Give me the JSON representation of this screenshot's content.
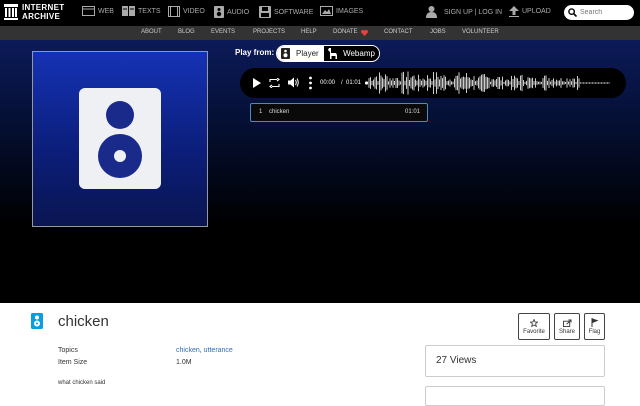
{
  "topbar": {
    "logo": {
      "line1": "INTERNET",
      "line2": "ARCHIVE"
    },
    "nav": [
      {
        "label": "WEB",
        "icon": "web-icon"
      },
      {
        "label": "TEXTS",
        "icon": "texts-icon"
      },
      {
        "label": "VIDEO",
        "icon": "video-icon"
      },
      {
        "label": "AUDIO",
        "icon": "audio-icon"
      },
      {
        "label": "SOFTWARE",
        "icon": "software-icon"
      },
      {
        "label": "IMAGES",
        "icon": "images-icon"
      }
    ],
    "signup": "SIGN UP | LOG IN",
    "upload": "UPLOAD",
    "search_placeholder": "Search"
  },
  "subnav": [
    "ABOUT",
    "BLOG",
    "EVENTS",
    "PROJECTS",
    "HELP",
    "DONATE",
    "CONTACT",
    "JOBS",
    "VOLUNTEER"
  ],
  "player": {
    "play_from": "Play from:",
    "mode_player": "Player",
    "mode_webamp": "Webamp",
    "current_time": "00:00",
    "separator": "/",
    "duration": "01:01",
    "tracks": [
      {
        "number": "1",
        "title": "chicken",
        "length": "01:01"
      }
    ]
  },
  "item": {
    "title": "chicken",
    "actions": {
      "favorite": "Favorite",
      "share": "Share",
      "flag": "Flag"
    },
    "topics_label": "Topics",
    "topics": [
      "chicken",
      "utterance"
    ],
    "topics_sep": ",",
    "size_label": "Item Size",
    "size_value": "1.0M",
    "description": "what chicken said",
    "views": "27 Views"
  },
  "colors": {
    "theater": "#051035",
    "link": "#2f6eb5",
    "cover": "#1532b4"
  }
}
